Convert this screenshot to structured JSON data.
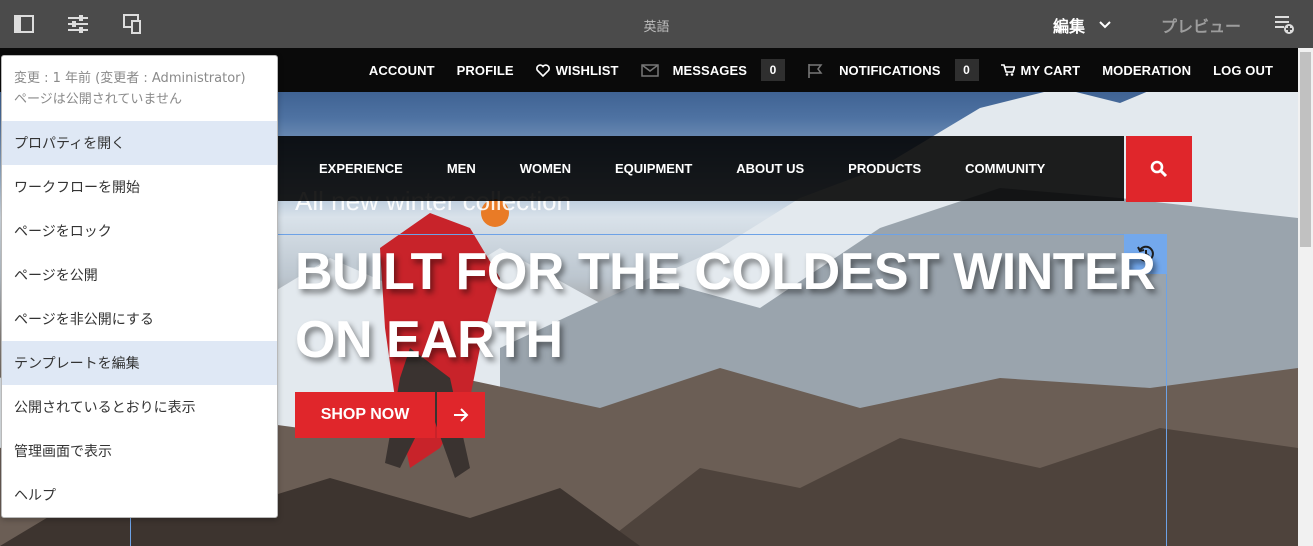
{
  "editor": {
    "language": "英語",
    "mode": "編集",
    "preview": "プレビュー"
  },
  "top_nav": {
    "account": "ACCOUNT",
    "profile": "PROFILE",
    "wishlist": "WISHLIST",
    "messages": "MESSAGES",
    "messages_count": "0",
    "notifications": "NOTIFICATIONS",
    "notifications_count": "0",
    "cart": "MY CART",
    "moderation": "MODERATION",
    "logout": "LOG OUT"
  },
  "main_nav": {
    "items": [
      "EXPERIENCE",
      "MEN",
      "WOMEN",
      "EQUIPMENT",
      "ABOUT US",
      "PRODUCTS",
      "COMMUNITY"
    ]
  },
  "hero": {
    "subtitle": "All new winter collection",
    "title_line1": "BUILT FOR THE COLDEST WINTER",
    "title_line2": "ON EARTH",
    "cta": "SHOP NOW"
  },
  "menu": {
    "meta_modified": "変更 : 1 年前 (変更者 : Administrator)",
    "meta_status": "ページは公開されていません",
    "items": [
      "プロパティを開く",
      "ワークフローを開始",
      "ページをロック",
      "ページを公開",
      "ページを非公開にする",
      "テンプレートを編集",
      "公開されているとおりに表示",
      "管理画面で表示",
      "ヘルプ"
    ]
  },
  "colors": {
    "toolbar": "#4b4b4b",
    "brand_red": "#e0262b",
    "menu_highlight": "#dfe8f5",
    "frame_blue": "#6da2e6"
  }
}
